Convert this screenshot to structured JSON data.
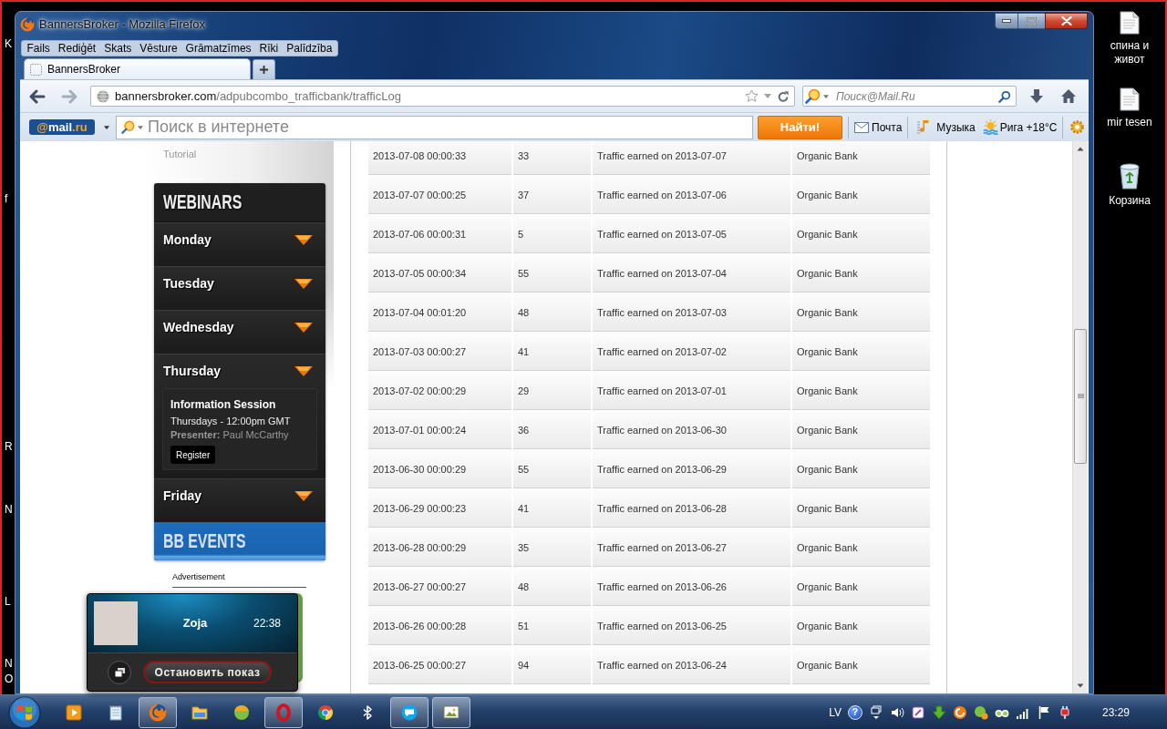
{
  "desktop": {
    "left_label_fragments": [
      "K",
      "f",
      "R",
      "N",
      "L",
      "N",
      "O"
    ],
    "shortcuts": [
      {
        "label": "спина и живот",
        "kind": "document"
      },
      {
        "label": "mir tesen",
        "kind": "document"
      },
      {
        "label": "Корзина",
        "kind": "trash"
      }
    ]
  },
  "window": {
    "title": "BannersBroker - Mozilla Firefox"
  },
  "menu": [
    "Fails",
    "Rediģēt",
    "Skats",
    "Vēsture",
    "Grāmatzīmes",
    "Rīki",
    "Palīdzība"
  ],
  "tabs": [
    {
      "label": "BannersBroker",
      "selected": true
    }
  ],
  "nav_buttons": [
    {
      "kind": "back",
      "disabled": false
    },
    {
      "kind": "forward",
      "disabled": true
    }
  ],
  "address_bar": {
    "domain": "bannersbroker.com",
    "path": "/adpubcombo_trafficbank/trafficLog"
  },
  "search_box": {
    "placeholder": "Поиск@Mail.Ru"
  },
  "mail_toolbar": {
    "logo": {
      "prefix": "@",
      "name": "mail",
      "suffix": ".ru"
    },
    "search": {
      "placeholder": "Поиск в интернете"
    },
    "search_button": "Найти!",
    "links": [
      {
        "kind": "mail",
        "label": "Почта"
      },
      {
        "kind": "music",
        "label": "Музыка"
      },
      {
        "kind": "weather",
        "label": "Рига +18°C"
      }
    ]
  },
  "sidebar": {
    "tutorial": "Tutorial",
    "webinars": {
      "title": "WEBINARS",
      "days": [
        {
          "label": "Monday",
          "expanded": false
        },
        {
          "label": "Tuesday",
          "expanded": false
        },
        {
          "label": "Wednesday",
          "expanded": false
        },
        {
          "label": "Thursday",
          "expanded": true,
          "session": {
            "title": "Information Session",
            "schedule": "Thursdays - 12:00pm GMT",
            "presenter": "**Presenter:** Paul McCarthy",
            "button": "Register"
          }
        },
        {
          "label": "Friday",
          "expanded": false
        }
      ]
    },
    "events_title": "BB EVENTS",
    "advertisement": "Advertisement"
  },
  "table": {
    "rows": [
      [
        "2013-07-08 00:00:33",
        "33",
        "Traffic earned on 2013-07-07",
        "Organic Bank"
      ],
      [
        "2013-07-07 00:00:25",
        "37",
        "Traffic earned on 2013-07-06",
        "Organic Bank"
      ],
      [
        "2013-07-06 00:00:31",
        "5",
        "Traffic earned on 2013-07-05",
        "Organic Bank"
      ],
      [
        "2013-07-05 00:00:34",
        "55",
        "Traffic earned on 2013-07-04",
        "Organic Bank"
      ],
      [
        "2013-07-04 00:01:20",
        "48",
        "Traffic earned on 2013-07-03",
        "Organic Bank"
      ],
      [
        "2013-07-03 00:00:27",
        "41",
        "Traffic earned on 2013-07-02",
        "Organic Bank"
      ],
      [
        "2013-07-02 00:00:29",
        "29",
        "Traffic earned on 2013-07-01",
        "Organic Bank"
      ],
      [
        "2013-07-01 00:00:24",
        "36",
        "Traffic earned on 2013-06-30",
        "Organic Bank"
      ],
      [
        "2013-06-30 00:00:29",
        "55",
        "Traffic earned on 2013-06-29",
        "Organic Bank"
      ],
      [
        "2013-06-29 00:00:23",
        "41",
        "Traffic earned on 2013-06-28",
        "Organic Bank"
      ],
      [
        "2013-06-28 00:00:29",
        "35",
        "Traffic earned on 2013-06-27",
        "Organic Bank"
      ],
      [
        "2013-06-27 00:00:27",
        "48",
        "Traffic earned on 2013-06-26",
        "Organic Bank"
      ],
      [
        "2013-06-26 00:00:28",
        "51",
        "Traffic earned on 2013-06-25",
        "Organic Bank"
      ],
      [
        "2013-06-25 00:00:27",
        "94",
        "Traffic earned on 2013-06-24",
        "Organic Bank"
      ]
    ]
  },
  "popup": {
    "name": "Zoja",
    "time": "22:38",
    "button": "Остановить показ"
  },
  "taskbar": {
    "apps": [
      {
        "kind": "player",
        "open": false
      },
      {
        "kind": "notes",
        "open": false
      },
      {
        "kind": "browser",
        "open": true
      },
      {
        "kind": "folder",
        "open": false
      },
      {
        "kind": "ball",
        "open": false
      },
      {
        "kind": "ring",
        "open": true
      },
      {
        "kind": "wheel",
        "open": false
      },
      {
        "kind": "bluetooth",
        "open": false
      },
      {
        "kind": "chat",
        "open": true
      },
      {
        "kind": "picture",
        "open": true
      }
    ],
    "language": "LV",
    "help_glyph": "?",
    "clock": "23:29"
  }
}
